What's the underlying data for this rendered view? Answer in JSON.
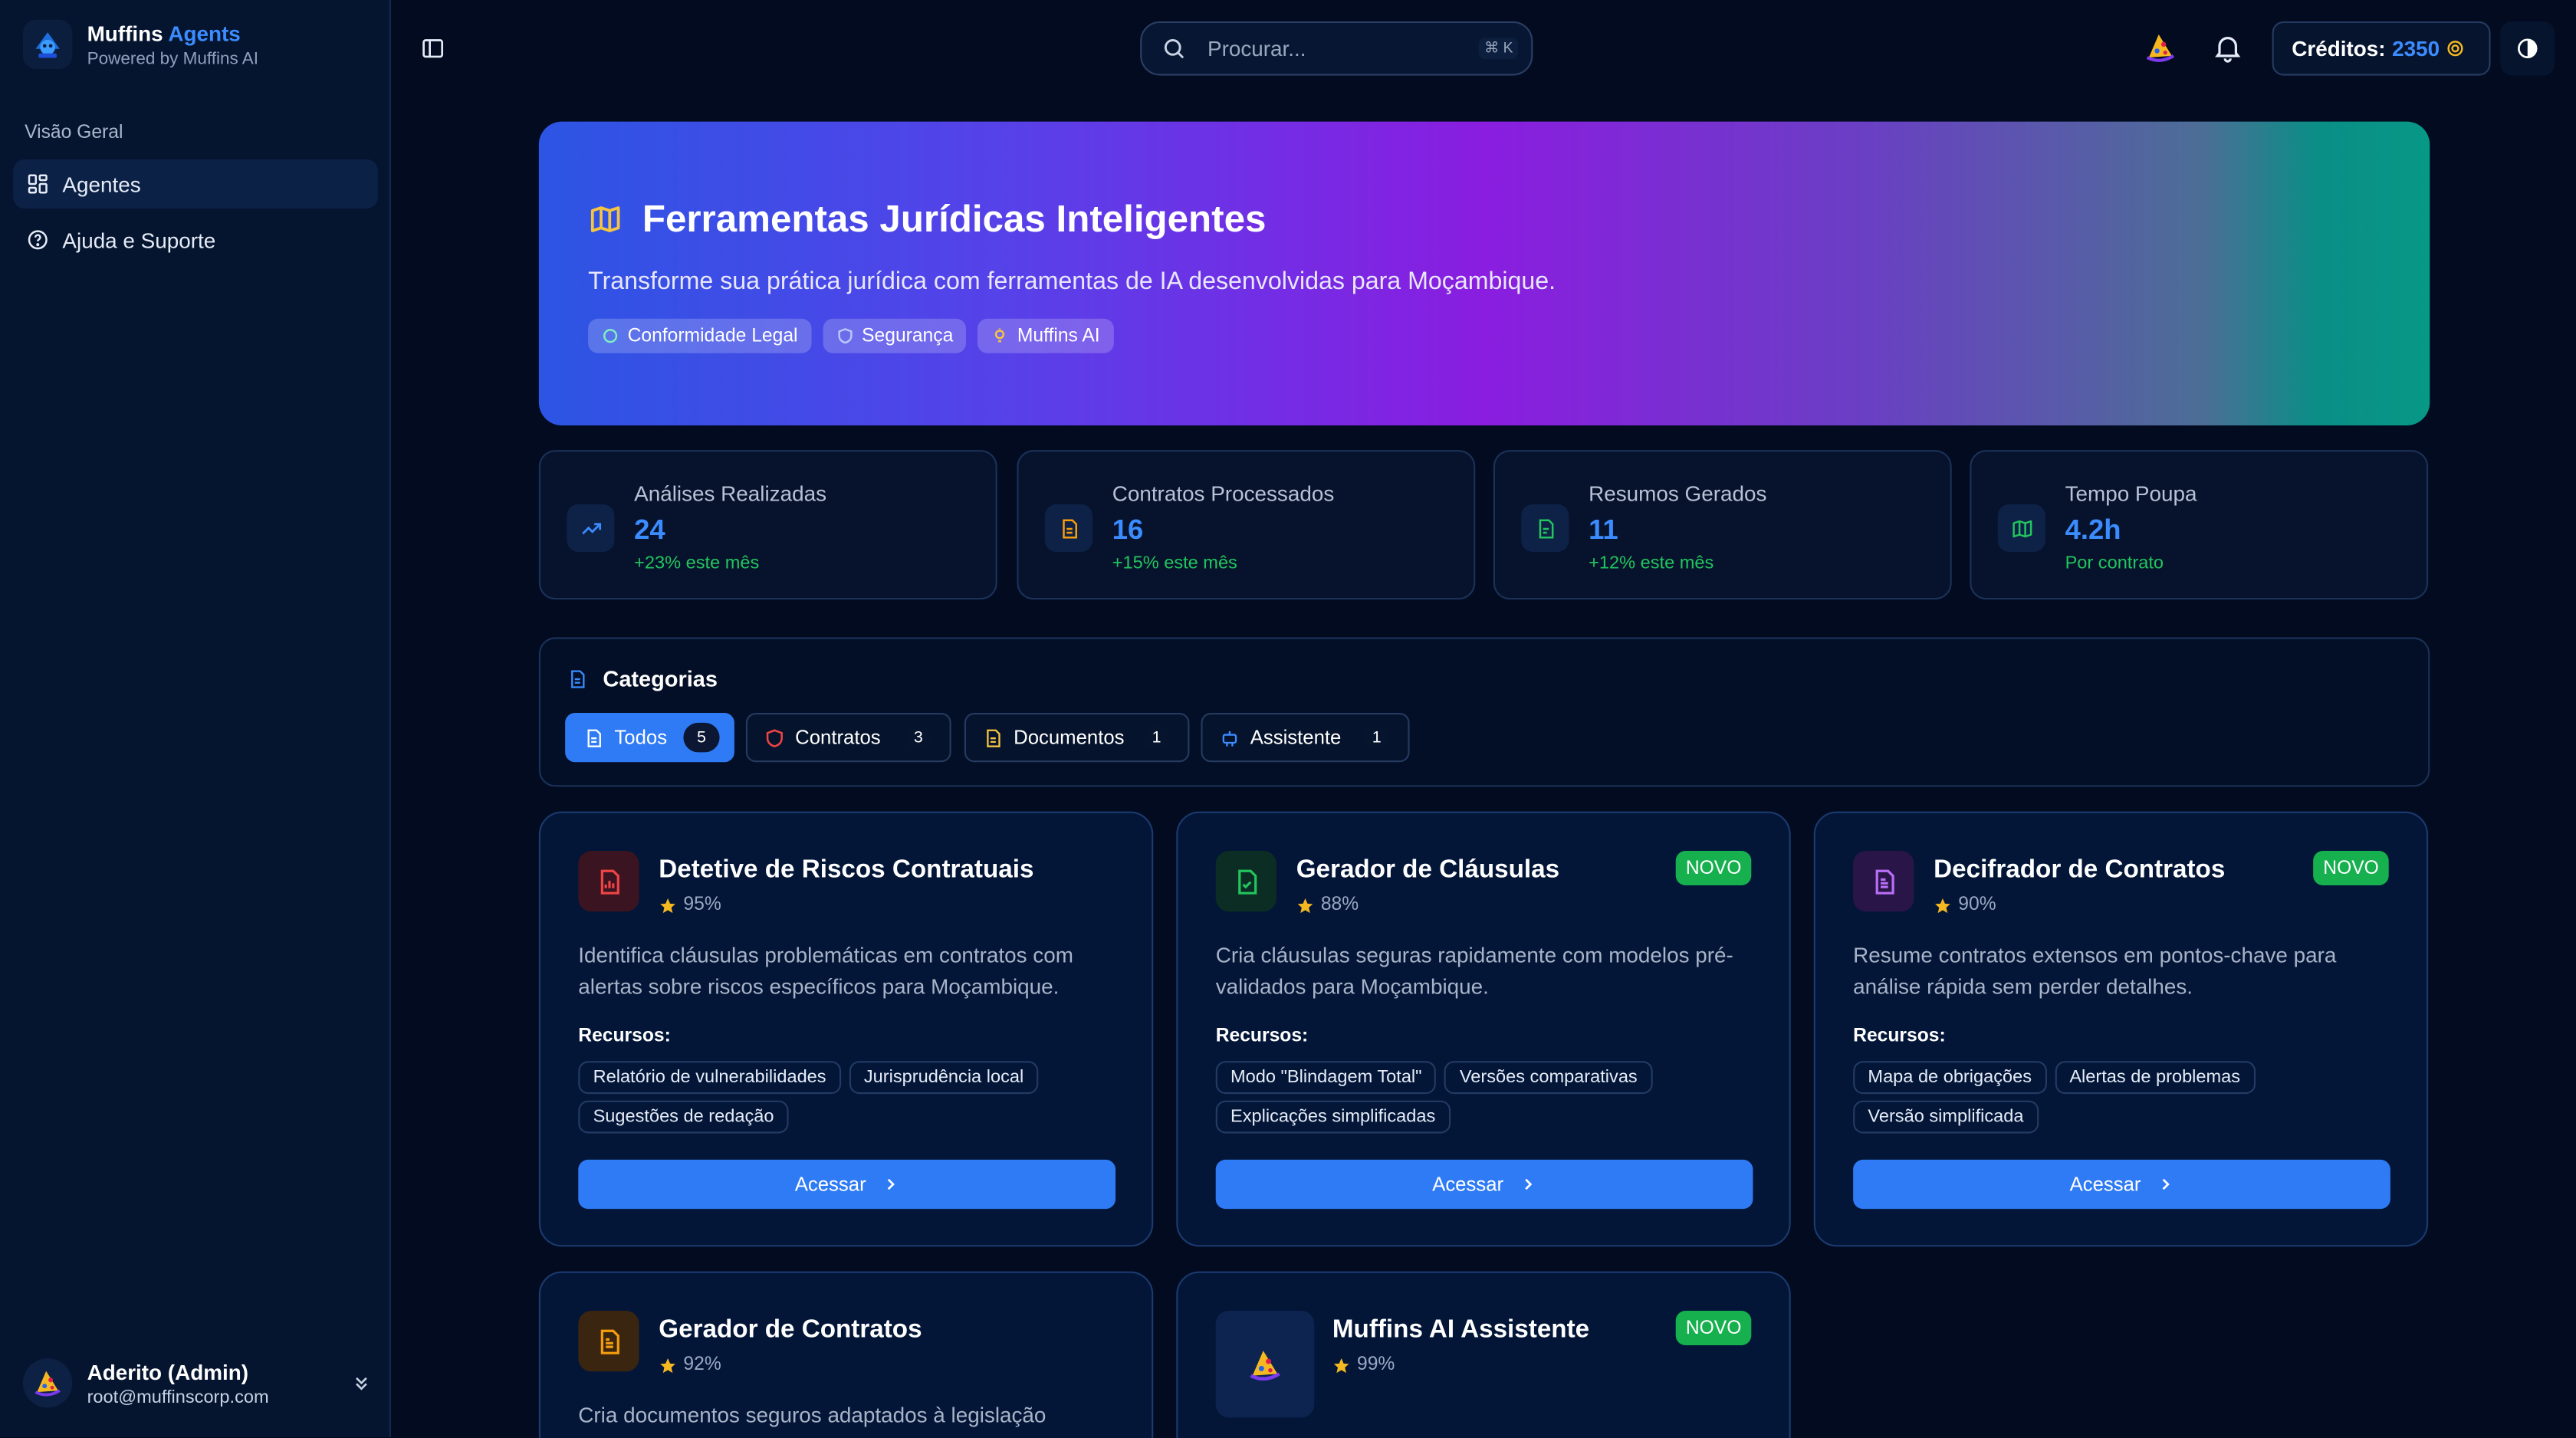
{
  "brand": {
    "name": "Muffins",
    "name_accent": "Agents",
    "tagline": "Powered by Muffins AI"
  },
  "nav": {
    "section": "Visão Geral",
    "items": [
      {
        "label": "Agentes",
        "icon": "grid-icon",
        "active": true
      },
      {
        "label": "Ajuda e Suporte",
        "icon": "help-circle-icon",
        "active": false
      }
    ]
  },
  "user": {
    "name": "Aderito (Admin)",
    "email": "root@muffinscorp.com"
  },
  "topbar": {
    "search_placeholder": "Procurar...",
    "shortcut": "⌘ K",
    "credits_label": "Créditos:",
    "credits_value": "2350"
  },
  "hero": {
    "title": "Ferramentas Jurídicas Inteligentes",
    "subtitle": "Transforme sua prática jurídica com ferramentas de IA desenvolvidas para Moçambique.",
    "chips": [
      {
        "label": "Conformidade Legal",
        "icon": "circle-icon"
      },
      {
        "label": "Segurança",
        "icon": "shield-icon"
      },
      {
        "label": "Muffins AI",
        "icon": "lightbulb-icon"
      }
    ]
  },
  "stats": [
    {
      "label": "Análises Realizadas",
      "value": "24",
      "change": "+23% este mês",
      "icon": "trending-up-icon"
    },
    {
      "label": "Contratos Processados",
      "value": "16",
      "change": "+15% este mês",
      "icon": "file-text-icon"
    },
    {
      "label": "Resumos Gerados",
      "value": "11",
      "change": "+12% este mês",
      "icon": "file-icon"
    },
    {
      "label": "Tempo Poupa",
      "value": "4.2h",
      "change": "Por contrato",
      "icon": "map-icon"
    }
  ],
  "categories": {
    "title": "Categorias",
    "tabs": [
      {
        "label": "Todos",
        "count": "5",
        "active": true
      },
      {
        "label": "Contratos",
        "count": "3",
        "active": false
      },
      {
        "label": "Documentos",
        "count": "1",
        "active": false
      },
      {
        "label": "Assistente",
        "count": "1",
        "active": false
      }
    ]
  },
  "resources_label": "Recursos:",
  "access_label": "Acessar",
  "cards": [
    {
      "title": "Detetive de Riscos Contratuais",
      "rating": "95%",
      "badge": "",
      "desc": "Identifica cláusulas problemáticas em contratos com alertas sobre riscos específicos para Moçambique.",
      "features": [
        "Relatório de vulnerabilidades",
        "Jurisprudência local",
        "Sugestões de redação"
      ],
      "icon": "file-chart-icon",
      "color": "#ef4444"
    },
    {
      "title": "Gerador de Cláusulas",
      "rating": "88%",
      "badge": "NOVO",
      "desc": "Cria cláusulas seguras rapidamente com modelos pré-validados para Moçambique.",
      "features": [
        "Modo \"Blindagem Total\"",
        "Versões comparativas",
        "Explicações simplificadas"
      ],
      "icon": "file-check-icon",
      "color": "#22c55e"
    },
    {
      "title": "Decifrador de Contratos",
      "rating": "90%",
      "badge": "NOVO",
      "desc": "Resume contratos extensos em pontos-chave para análise rápida sem perder detalhes.",
      "features": [
        "Mapa de obrigações",
        "Alertas de problemas",
        "Versão simplificada"
      ],
      "icon": "file-lines-icon",
      "color": "#a855f7"
    },
    {
      "title": "Gerador de Contratos",
      "rating": "92%",
      "badge": "",
      "desc": "Cria documentos seguros adaptados à legislação",
      "features": [],
      "icon": "file-text-icon",
      "color": "#f59e0b"
    },
    {
      "title": "Muffins AI Assistente",
      "rating": "99%",
      "badge": "NOVO",
      "desc": "",
      "features": [],
      "icon": "muffin-icon",
      "color": "#3b8cff"
    }
  ]
}
